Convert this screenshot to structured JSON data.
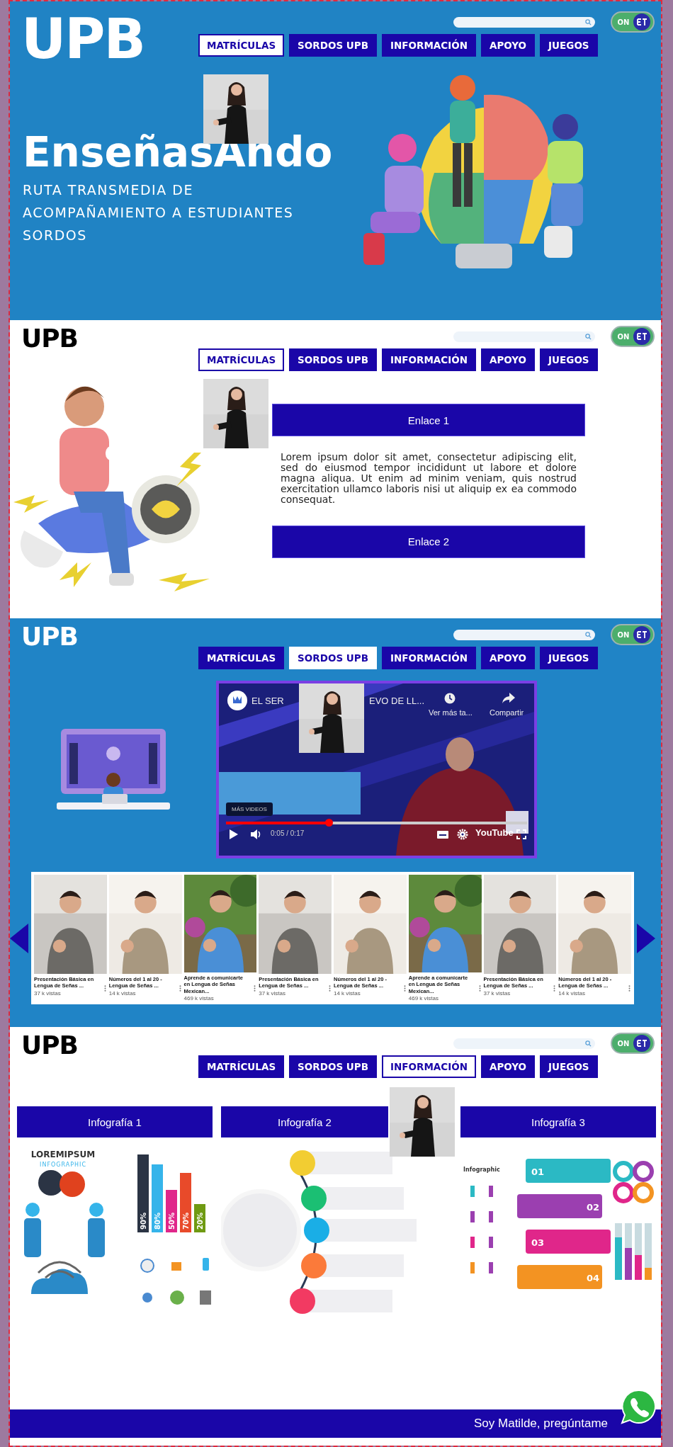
{
  "sections": [
    {
      "kind": "hero",
      "header": {
        "logo": "UPB",
        "toggle": {
          "label": "ON",
          "on": true
        },
        "nav": [
          {
            "label": "MATRÍCULAS",
            "selected": true
          },
          {
            "label": "SORDOS UPB",
            "selected": false
          },
          {
            "label": "INFORMACIÓN",
            "selected": false
          },
          {
            "label": "APOYO",
            "selected": false
          },
          {
            "label": "JUEGOS",
            "selected": false
          }
        ]
      },
      "title": "EnseñasAndo",
      "subtitle": "RUTA TRANSMEDIA DE ACOMPAÑAMIENTO A ESTUDIANTES SORDOS"
    },
    {
      "kind": "links",
      "header": {
        "logo": "UPB",
        "toggle": {
          "label": "ON",
          "on": true
        },
        "nav": [
          {
            "label": "MATRÍCULAS",
            "selected": true
          },
          {
            "label": "SORDOS UPB",
            "selected": false
          },
          {
            "label": "INFORMACIÓN",
            "selected": false
          },
          {
            "label": "APOYO",
            "selected": false
          },
          {
            "label": "JUEGOS",
            "selected": false
          }
        ]
      },
      "link_top": "Enlace 1",
      "text": "Lorem ipsum dolor sit amet, consectetur adipiscing elit, sed do eiusmod tempor incididunt ut labore et dolore magna aliqua. Ut enim ad minim veniam, quis nostrud exercitation ullamco laboris nisi ut aliquip ex ea commodo consequat.",
      "link_bottom": "Enlace 2"
    },
    {
      "kind": "videos",
      "header": {
        "logo": "UPB",
        "toggle": {
          "label": "ON",
          "on": true
        },
        "nav": [
          {
            "label": "MATRÍCULAS",
            "selected": false
          },
          {
            "label": "SORDOS UPB",
            "selected": true
          },
          {
            "label": "INFORMACIÓN",
            "selected": false
          },
          {
            "label": "APOYO",
            "selected": false
          },
          {
            "label": "JUEGOS",
            "selected": false
          }
        ]
      },
      "video": {
        "title_start": "EL SER",
        "title_end": "EVO DE LL...",
        "watch_later": "Ver más ta...",
        "share": "Compartir",
        "more_videos": "MÁS VIDEOS",
        "time": "0:05 / 0:17",
        "brand": "YouTube",
        "level": 0.34
      },
      "thumbnails": [
        {
          "title": "Presentación Básica en Lengua de Señas ...",
          "views": "37 k vistas"
        },
        {
          "title": "Números del 1 al 20 - Lengua de Señas ...",
          "views": "14 k vistas"
        },
        {
          "title": "Aprende a comunicarte en Lengua de Señas Mexican...",
          "views": "469 k vistas"
        },
        {
          "title": "Presentación Básica en Lengua de Señas ...",
          "views": "37 k vistas"
        },
        {
          "title": "Números del 1 al 20 - Lengua de Señas ...",
          "views": "14 k vistas"
        },
        {
          "title": "Aprende a comunicarte en Lengua de Señas Mexican...",
          "views": "469 k vistas"
        },
        {
          "title": "Presentación Básica en Lengua de Señas ...",
          "views": "37 k vistas"
        },
        {
          "title": "Números del 1 al 20 - Lengua de Señas ...",
          "views": "14 k vistas"
        }
      ]
    },
    {
      "kind": "infographics",
      "header": {
        "logo": "UPB",
        "toggle": {
          "label": "ON",
          "on": true
        },
        "nav": [
          {
            "label": "MATRÍCULAS",
            "selected": false
          },
          {
            "label": "SORDOS UPB",
            "selected": false
          },
          {
            "label": "INFORMACIÓN",
            "selected": true
          },
          {
            "label": "APOYO",
            "selected": false
          },
          {
            "label": "JUEGOS",
            "selected": false
          }
        ]
      },
      "infographics": [
        {
          "kind": "people",
          "label": "Infografía 1",
          "heading": "LOREMIPSUM",
          "subheading": "INFOGRAPHIC",
          "bar_labels": [
            "90%",
            "80%",
            "50%",
            "70%",
            "20%"
          ]
        },
        {
          "kind": "tree",
          "label": "Infografía 2"
        },
        {
          "kind": "steps",
          "label": "Infografía 3",
          "heading": "Infographic",
          "steps": [
            {
              "label": "01",
              "color": "#2bb9c4"
            },
            {
              "label": "02",
              "color": "#9b3fb0"
            },
            {
              "label": "03",
              "color": "#e0268a"
            },
            {
              "label": "04",
              "color": "#f39322"
            }
          ]
        }
      ],
      "chat": {
        "label": "Soy Matilde, pregúntame"
      }
    }
  ]
}
